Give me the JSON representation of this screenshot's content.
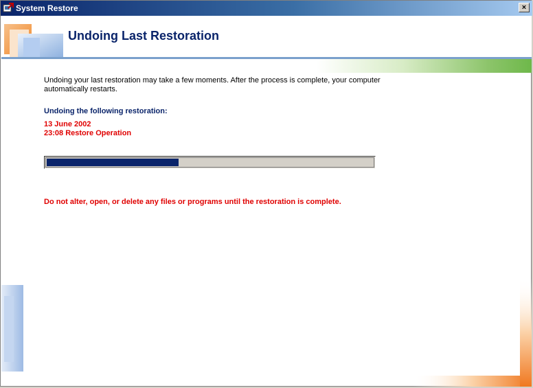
{
  "window": {
    "title": "System Restore",
    "close_label": "×"
  },
  "header": {
    "title": "Undoing Last Restoration"
  },
  "main": {
    "description": "Undoing your last restoration may take a few moments. After the process is complete, your computer automatically restarts.",
    "section_label": "Undoing the following restoration:",
    "restore_date": "13 June 2002",
    "restore_operation": "23:08 Restore Operation",
    "progress_fraction": 0.405,
    "warning": "Do not alter, open, or delete any files or programs until the restoration is complete."
  },
  "icons": {
    "app": "system-restore-icon",
    "close": "close-icon",
    "header_logo": "restore-logo-icon"
  },
  "colors": {
    "title_blue": "#0a246a",
    "warning_red": "#e00000",
    "progress_fill": "#0a246a",
    "accent_green": "#6eb84a",
    "accent_orange": "#f07820"
  }
}
